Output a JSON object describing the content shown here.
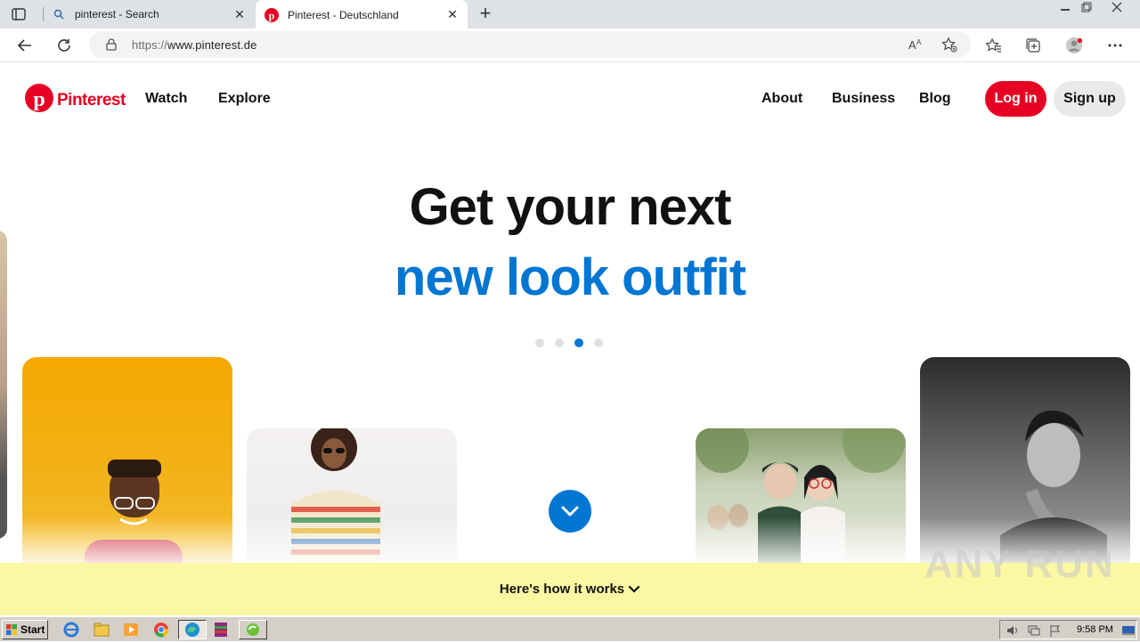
{
  "browser": {
    "tabs": [
      {
        "title": "pinterest - Search",
        "icon": "search-icon"
      },
      {
        "title": "Pinterest - Deutschland",
        "icon": "pinterest-logo-icon"
      }
    ],
    "url_prefix": "https://",
    "url_host": "www.pinterest.de"
  },
  "site": {
    "logo_text": "Pinterest",
    "nav_left": [
      "Watch",
      "Explore"
    ],
    "nav_right": [
      "About",
      "Business",
      "Blog"
    ],
    "login_label": "Log in",
    "signup_label": "Sign up"
  },
  "hero": {
    "line1": "Get your next",
    "line2": "new look outfit",
    "carousel_dots": 4,
    "active_dot": 3
  },
  "banner": {
    "label": "Here's how it works"
  },
  "watermark": "ANY RUN",
  "taskbar": {
    "start_label": "Start",
    "clock": "9:58 PM"
  },
  "colors": {
    "brand_red": "#e60023",
    "accent_blue": "#0076d3",
    "banner_yellow": "#fbf7a3"
  }
}
